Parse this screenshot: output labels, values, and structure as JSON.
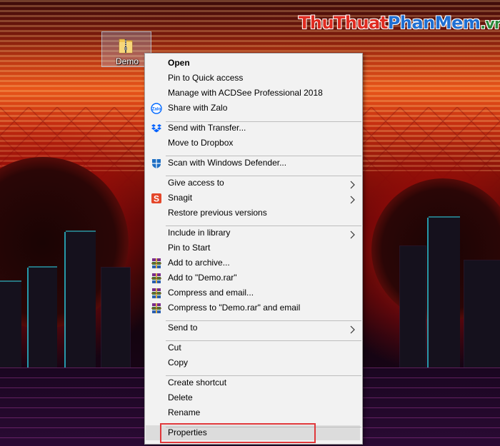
{
  "watermark": {
    "part1": "Thu",
    "part2": "Thuat",
    "part3": "PhanMem",
    "part4": ".vn"
  },
  "desktop": {
    "icon_label": "Demo"
  },
  "context_menu": {
    "items": [
      {
        "label": "Open",
        "icon": "",
        "submenu": false
      },
      {
        "label": "Pin to Quick access",
        "icon": "",
        "submenu": false
      },
      {
        "label": "Manage with ACDSee Professional 2018",
        "icon": "",
        "submenu": false
      },
      {
        "label": "Share with Zalo",
        "icon": "zalo-icon",
        "submenu": false
      },
      {
        "label": "Send with Transfer...",
        "icon": "dropbox-icon",
        "submenu": false
      },
      {
        "label": "Move to Dropbox",
        "icon": "",
        "submenu": false
      },
      {
        "label": "Scan with Windows Defender...",
        "icon": "windows-defender-icon",
        "submenu": false
      },
      {
        "label": "Give access to",
        "icon": "",
        "submenu": true
      },
      {
        "label": "Snagit",
        "icon": "snagit-icon",
        "submenu": true
      },
      {
        "label": "Restore previous versions",
        "icon": "",
        "submenu": false
      },
      {
        "label": "Include in library",
        "icon": "",
        "submenu": true
      },
      {
        "label": "Pin to Start",
        "icon": "",
        "submenu": false
      },
      {
        "label": "Add to archive...",
        "icon": "winrar-icon",
        "submenu": false
      },
      {
        "label": "Add to \"Demo.rar\"",
        "icon": "winrar-icon",
        "submenu": false
      },
      {
        "label": "Compress and email...",
        "icon": "winrar-icon",
        "submenu": false
      },
      {
        "label": "Compress to \"Demo.rar\" and email",
        "icon": "winrar-icon",
        "submenu": false
      },
      {
        "label": "Send to",
        "icon": "",
        "submenu": true
      },
      {
        "label": "Cut",
        "icon": "",
        "submenu": false
      },
      {
        "label": "Copy",
        "icon": "",
        "submenu": false
      },
      {
        "label": "Create shortcut",
        "icon": "",
        "submenu": false
      },
      {
        "label": "Delete",
        "icon": "",
        "submenu": false
      },
      {
        "label": "Rename",
        "icon": "",
        "submenu": false
      },
      {
        "label": "Properties",
        "icon": "",
        "submenu": false,
        "highlighted": true
      }
    ]
  },
  "colors": {
    "menu_bg": "#f2f2f2",
    "highlight_box": "#e0373a",
    "winrar": "#7a2a8a",
    "dropbox": "#0061fe",
    "snagit": "#e4472a",
    "defender": "#1e6fc4",
    "zalo": "#0068ff"
  }
}
